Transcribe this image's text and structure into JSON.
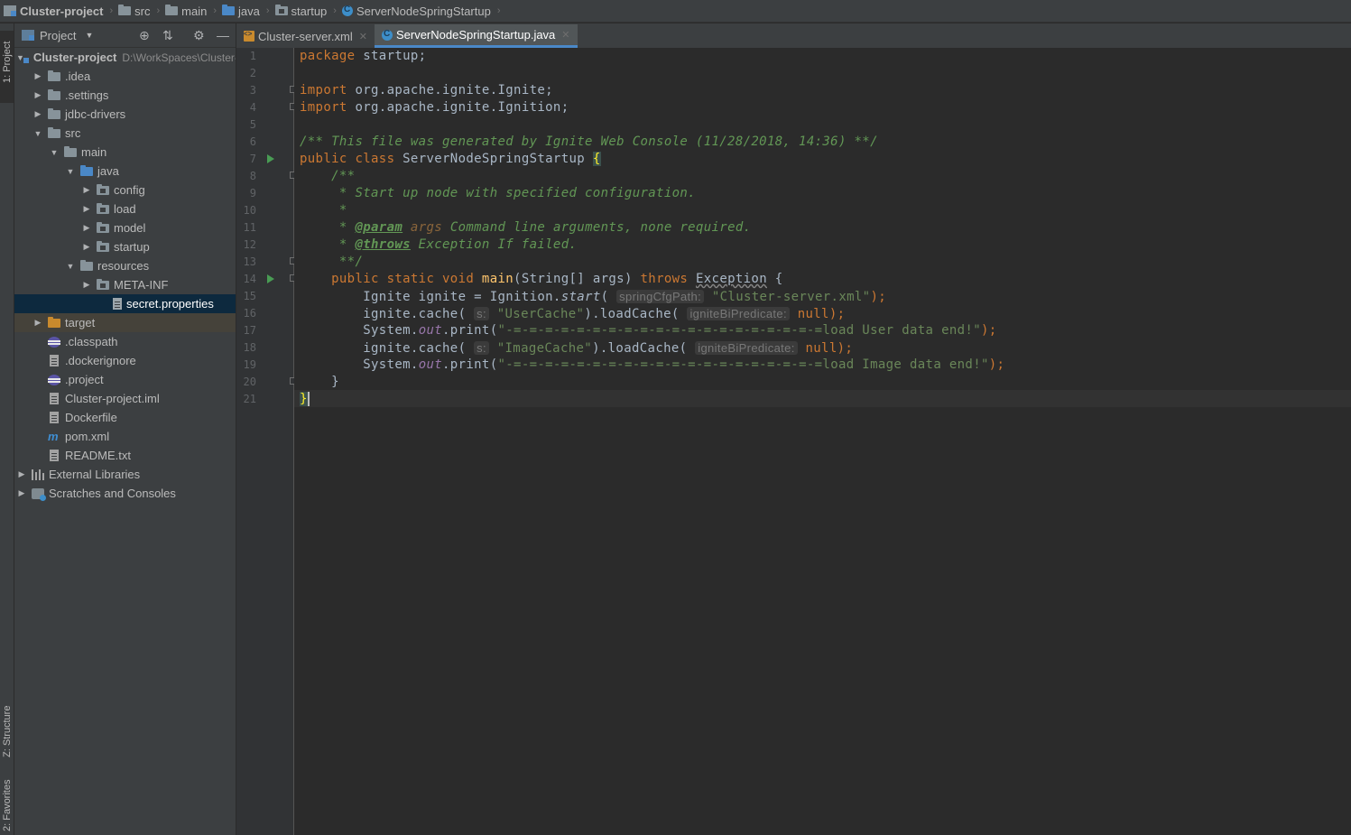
{
  "breadcrumb": {
    "items": [
      {
        "label": "Cluster-project",
        "icon": "project-icon"
      },
      {
        "label": "src",
        "icon": "folder-icon"
      },
      {
        "label": "main",
        "icon": "folder-icon"
      },
      {
        "label": "java",
        "icon": "folder-icon"
      },
      {
        "label": "startup",
        "icon": "package-icon"
      },
      {
        "label": "ServerNodeSpringStartup",
        "icon": "class-icon"
      }
    ]
  },
  "tool_strip": {
    "project_tab": "1: Project",
    "structure_tab": "Z: Structure",
    "favorites_tab": "2: Favorites"
  },
  "project_panel": {
    "title": "Project",
    "tree": [
      {
        "label": "Cluster-project",
        "path": "D:\\WorkSpaces\\Cluster-project",
        "bold": true
      },
      {
        "label": ".idea"
      },
      {
        "label": ".settings"
      },
      {
        "label": "jdbc-drivers"
      },
      {
        "label": "src"
      },
      {
        "label": "main"
      },
      {
        "label": "java"
      },
      {
        "label": "config"
      },
      {
        "label": "load"
      },
      {
        "label": "model"
      },
      {
        "label": "startup"
      },
      {
        "label": "resources"
      },
      {
        "label": "META-INF"
      },
      {
        "label": "secret.properties"
      },
      {
        "label": "target"
      },
      {
        "label": ".classpath"
      },
      {
        "label": ".dockerignore"
      },
      {
        "label": ".project"
      },
      {
        "label": "Cluster-project.iml"
      },
      {
        "label": "Dockerfile"
      },
      {
        "label": "pom.xml"
      },
      {
        "label": "README.txt"
      },
      {
        "label": "External Libraries"
      },
      {
        "label": "Scratches and Consoles"
      }
    ]
  },
  "tabs": [
    {
      "label": "Cluster-server.xml",
      "active": false
    },
    {
      "label": "ServerNodeSpringStartup.java",
      "active": true
    }
  ],
  "editor": {
    "line_numbers": [
      "1",
      "2",
      "3",
      "4",
      "5",
      "6",
      "7",
      "8",
      "9",
      "10",
      "11",
      "12",
      "13",
      "14",
      "15",
      "16",
      "17",
      "18",
      "19",
      "20",
      "21"
    ],
    "code": {
      "l1_kw": "package",
      "l1_rest": " startup;",
      "l3_kw": "import",
      "l3_rest": " org.apache.ignite.Ignite;",
      "l4_kw": "import",
      "l4_rest": " org.apache.ignite.Ignition;",
      "l6": "/** This file was generated by Ignite Web Console (11/28/2018, 14:36) **/",
      "l7_kw": "public class",
      "l7_name": " ServerNodeSpringStartup ",
      "l7_brace": "{",
      "l8": "    /**",
      "l9": "     * Start up node with specified configuration.",
      "l10": "     *",
      "l11_pre": "     * ",
      "l11_tag": "@param",
      "l11_prm": " args",
      "l11_rest": " Command line arguments, none required.",
      "l12_pre": "     * ",
      "l12_tag": "@throws",
      "l12_rest": " Exception If failed.",
      "l13": "     **/",
      "l14_kw": "    public static void",
      "l14_fn": " main",
      "l14_args": "(String[] args) ",
      "l14_throws": "throws",
      "l14_exc": "Exception",
      "l14_end": " {",
      "l15_pre": "        Ignite ignite = Ignition.",
      "l15_call": "start",
      "l15_open": "( ",
      "l15_hint": "springCfgPath:",
      "l15_str": "\"Cluster-server.xml\"",
      "l15_end": ");",
      "l16_pre": "        ignite.cache( ",
      "l16_hint": "s:",
      "l16_str": "\"UserCache\"",
      "l16_mid": ").loadCache( ",
      "l16_hint2": "igniteBiPredicate:",
      "l16_null": "null",
      "l16_end": ");",
      "l17_pre": "        System.",
      "l17_out": "out",
      "l17_mid": ".print(",
      "l17_str": "\"-=-=-=-=-=-=-=-=-=-=-=-=-=-=-=-=-=-=-=-=load User data end!\"",
      "l17_end": ");",
      "l18_pre": "        ignite.cache( ",
      "l18_hint": "s:",
      "l18_str": "\"ImageCache\"",
      "l18_mid": ").loadCache( ",
      "l18_hint2": "igniteBiPredicate:",
      "l18_null": "null",
      "l18_end": ");",
      "l19_pre": "        System.",
      "l19_out": "out",
      "l19_mid": ".print(",
      "l19_str": "\"-=-=-=-=-=-=-=-=-=-=-=-=-=-=-=-=-=-=-=-=load Image data end!\"",
      "l19_end": ");",
      "l20": "    }",
      "l21": "}"
    }
  },
  "colors": {
    "keyword": "#cc7832",
    "comment": "#629755",
    "string": "#6a8759",
    "selection": "#0d293e",
    "accent": "#4a88c7"
  }
}
